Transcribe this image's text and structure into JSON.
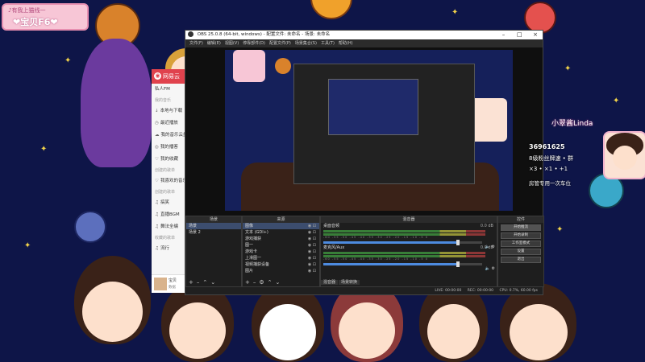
{
  "overlay": {
    "banner_top": "♪有我上猫线一",
    "banner_main": "❤宝贝F6❤"
  },
  "music_app": {
    "title": "网易云",
    "items": [
      {
        "type": "item",
        "icon": "",
        "label": "私人FM"
      },
      {
        "type": "section",
        "label": "我的音乐"
      },
      {
        "type": "item",
        "icon": "↓",
        "label": "本地与下载"
      },
      {
        "type": "item",
        "icon": "◷",
        "label": "最近播放"
      },
      {
        "type": "item",
        "icon": "☁",
        "label": "我的音乐云盘"
      },
      {
        "type": "item",
        "icon": "◎",
        "label": "我的播客"
      },
      {
        "type": "item",
        "icon": "♡",
        "label": "我的收藏"
      },
      {
        "type": "section",
        "label": "创建的歌单"
      },
      {
        "type": "item",
        "icon": "♡",
        "label": "我喜欢的音乐"
      },
      {
        "type": "section",
        "label": "创建的歌单"
      },
      {
        "type": "item",
        "icon": "♫",
        "label": "搞笑"
      },
      {
        "type": "item",
        "icon": "♫",
        "label": "直播BGM"
      },
      {
        "type": "item",
        "icon": "♫",
        "label": "舞法全编"
      },
      {
        "type": "section",
        "label": "收藏的歌单"
      },
      {
        "type": "item",
        "icon": "♫",
        "label": "流行"
      }
    ],
    "now_playing_title": "宝贝",
    "now_playing_sub": "数据"
  },
  "obs": {
    "title": "OBS 25.0.8 (64-bit, windows) - 配置文件: 未命名 - 场景: 未命名",
    "menu": [
      "文件(F)",
      "编辑(E)",
      "视图(V)",
      "停靠部件(D)",
      "配置文件(P)",
      "场景集合(S)",
      "工具(T)",
      "帮助(H)"
    ],
    "docks": {
      "scenes_title": "场景",
      "sources_title": "来源",
      "mixer_title": "混音器",
      "controls_title": "控件"
    },
    "scenes": [
      "场景",
      "场景 2"
    ],
    "sources": [
      "图像",
      "文本 (GDI+)",
      "游戏捕获",
      "图一",
      "游戏卡",
      "上滑图一",
      "视频捕获设备",
      "图片"
    ],
    "mixer": [
      {
        "name": "桌面音频",
        "value": "0.0 dB",
        "level": 0.85
      },
      {
        "name": "麦克风/Aux",
        "value": "0.0 dB",
        "level": 0.85
      }
    ],
    "mixer_scale": "-60 -55 -50 -45 -40 -35 -30 -25 -20 -15 -10 -5 0",
    "mixer_tabs": [
      "混音器",
      "场景转换"
    ],
    "controls": [
      "开始推流",
      "开始录制",
      "工作室模式",
      "设置",
      "退出"
    ],
    "status": {
      "live": "LIVE: 00:00:00",
      "rec": "REC: 00:00:00",
      "cpu": "CPU: 0.7%, 60.00 fps"
    }
  },
  "streamer_card": {
    "name": "小翠酱Linda",
    "followers": "36961625",
    "level_text": "8级粉丝牌速 • 群",
    "gift_text": "×3  • ×1 • +1",
    "footer": "房管专用一次车位"
  },
  "colors": {
    "obs_bg": "#202020",
    "music_accent": "#e0424d",
    "wallpaper": "#0e1548"
  }
}
